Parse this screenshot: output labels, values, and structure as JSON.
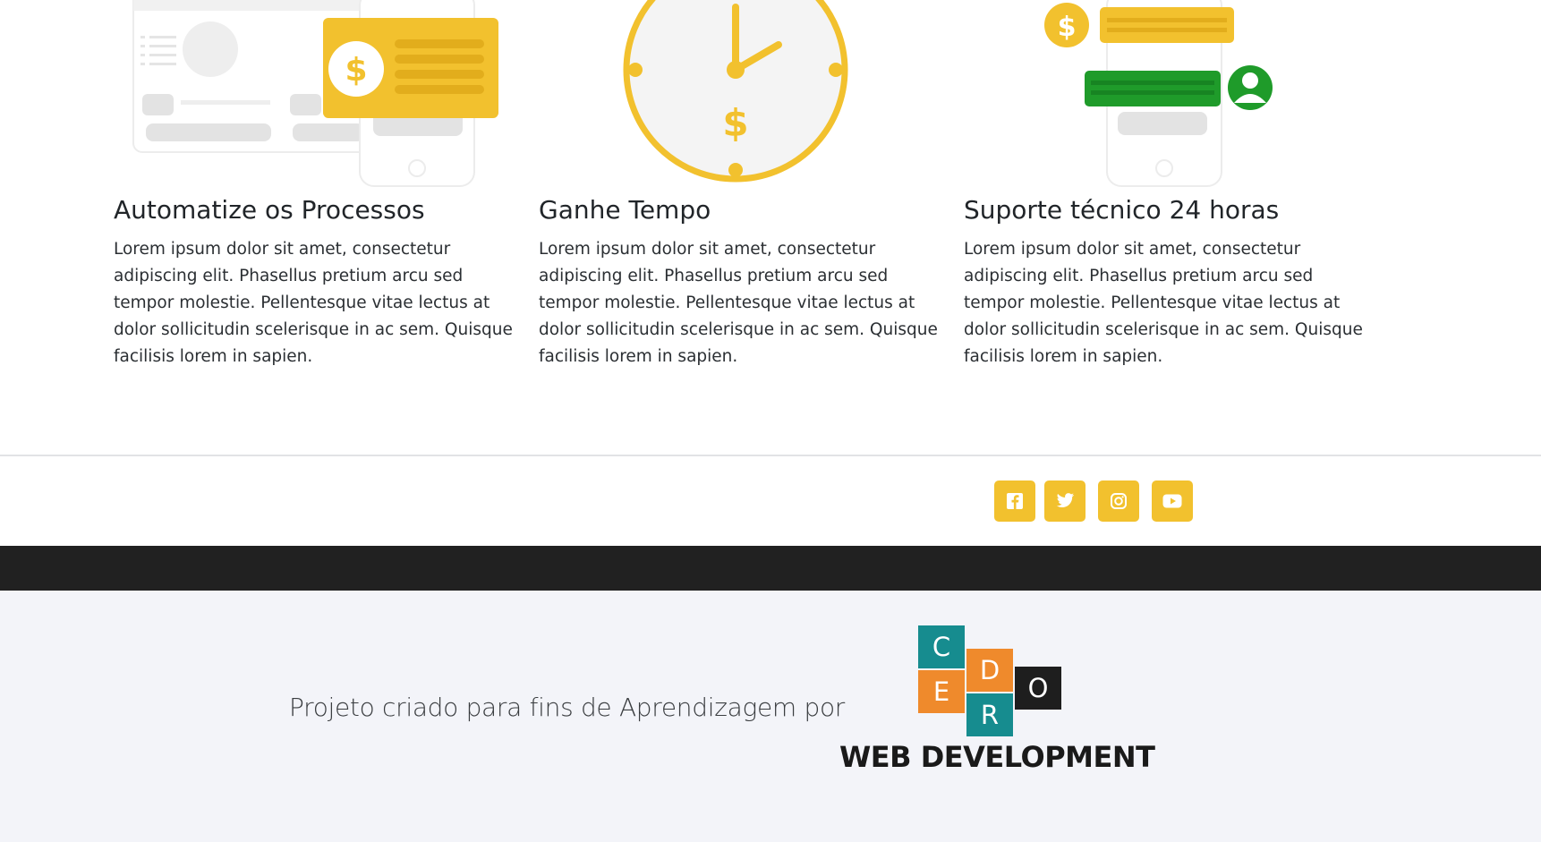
{
  "features": [
    {
      "title": "Automatize os Processos",
      "text": "Lorem ipsum dolor sit amet, consectetur adipiscing elit. Phasellus pretium arcu sed tempor molestie. Pellentesque vitae lectus at dolor sollicitudin scelerisque in ac sem. Quisque facilisis lorem in sapien.",
      "illustration": "payment-screens-illustration"
    },
    {
      "title": "Ganhe Tempo",
      "text": "Lorem ipsum dolor sit amet, consectetur adipiscing elit. Phasellus pretium arcu sed tempor molestie. Pellentesque vitae lectus at dolor sollicitudin scelerisque in ac sem. Quisque facilisis lorem in sapien.",
      "illustration": "clock-money-illustration"
    },
    {
      "title": "Suporte técnico 24 horas",
      "text": "Lorem ipsum dolor sit amet, consectetur adipiscing elit. Phasellus pretium arcu sed tempor molestie. Pellentesque vitae lectus at dolor sollicitudin scelerisque in ac sem. Quisque facilisis lorem in sapien.",
      "illustration": "chat-support-illustration"
    }
  ],
  "social": [
    {
      "name": "facebook",
      "icon": "facebook-icon"
    },
    {
      "name": "twitter",
      "icon": "twitter-icon"
    },
    {
      "name": "instagram",
      "icon": "instagram-icon"
    },
    {
      "name": "youtube",
      "icon": "youtube-icon"
    }
  ],
  "footer": {
    "credit": "Projeto criado para fins de Aprendizagem por",
    "logo": {
      "letters": {
        "c": "C",
        "e": "E",
        "d": "D",
        "r": "R",
        "o": "O"
      },
      "text": "WEB DEVELOPMENT"
    }
  },
  "colors": {
    "accent": "#f2c12e",
    "green": "#1f9b2a",
    "teal": "#168c8f",
    "orange": "#ef8a2c",
    "dark_band": "#212121",
    "footer_bg": "#f3f4f9"
  }
}
